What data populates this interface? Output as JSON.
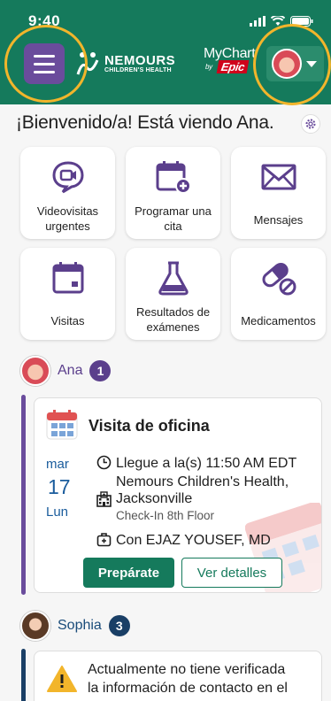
{
  "status": {
    "time": "9:40"
  },
  "header": {
    "brand_name": "NEMOURS",
    "brand_sub": "CHILDREN'S HEALTH",
    "mychart": "MyChart",
    "by": "by",
    "epic": "Epic",
    "color": "#157a5c"
  },
  "welcome": "¡Bienvenido/a! Está viendo Ana.",
  "tiles": [
    {
      "label": "Videovisitas urgentes",
      "icon": "video-chat-icon"
    },
    {
      "label": "Programar una cita",
      "icon": "calendar-add-icon"
    },
    {
      "label": "Mensajes",
      "icon": "envelope-icon"
    },
    {
      "label": "Visitas",
      "icon": "calendar-icon"
    },
    {
      "label": "Resultados de exámenes",
      "icon": "flask-icon"
    },
    {
      "label": "Medicamentos",
      "icon": "pill-icon"
    }
  ],
  "patients": [
    {
      "name": "Ana",
      "count": "1"
    },
    {
      "name": "Sophia",
      "count": "3"
    }
  ],
  "visit": {
    "title": "Visita de oficina",
    "month": "mar",
    "day": "17",
    "weekday": "Lun",
    "arrive": "Llegue a la(s) 11:50 AM EDT",
    "location_line1": "Nemours Children's Health,",
    "location_line2": "Jacksonville",
    "checkin": "Check-In 8th Floor",
    "provider": "Con EJAZ YOUSEF, MD",
    "prepare_label": "Prepárate",
    "details_label": "Ver detalles"
  },
  "alert": {
    "line1": "Actualmente no tiene verificada",
    "line2": "la información de contacto en el"
  }
}
